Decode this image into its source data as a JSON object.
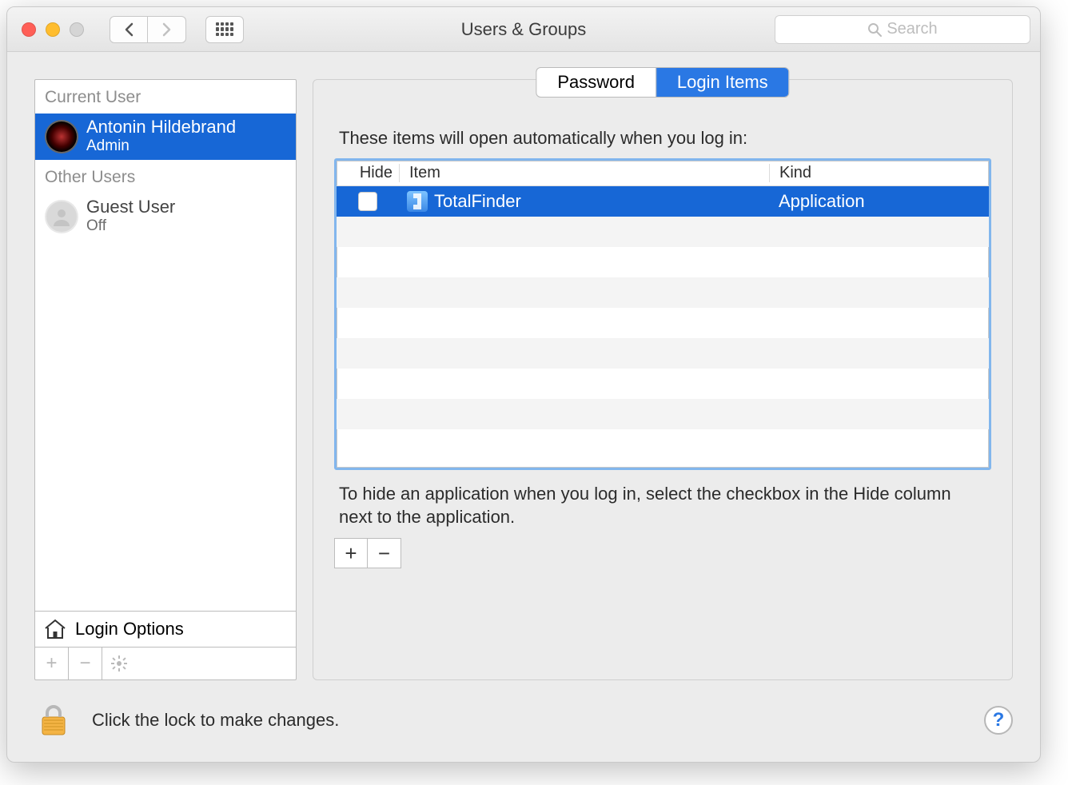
{
  "window": {
    "title": "Users & Groups"
  },
  "search": {
    "placeholder": "Search"
  },
  "sidebar": {
    "section_current": "Current User",
    "section_other": "Other Users",
    "current_user": {
      "name": "Antonin Hildebrand",
      "role": "Admin"
    },
    "other_users": [
      {
        "name": "Guest User",
        "role": "Off"
      }
    ],
    "login_options": "Login Options"
  },
  "tabs": {
    "password": "Password",
    "login_items": "Login Items"
  },
  "main": {
    "intro": "These items will open automatically when you log in:",
    "columns": {
      "hide": "Hide",
      "item": "Item",
      "kind": "Kind"
    },
    "rows": [
      {
        "item": "TotalFinder",
        "kind": "Application",
        "hide": false
      }
    ],
    "hint": "To hide an application when you log in, select the checkbox in the Hide column next to the application."
  },
  "lock": {
    "text": "Click the lock to make changes."
  }
}
